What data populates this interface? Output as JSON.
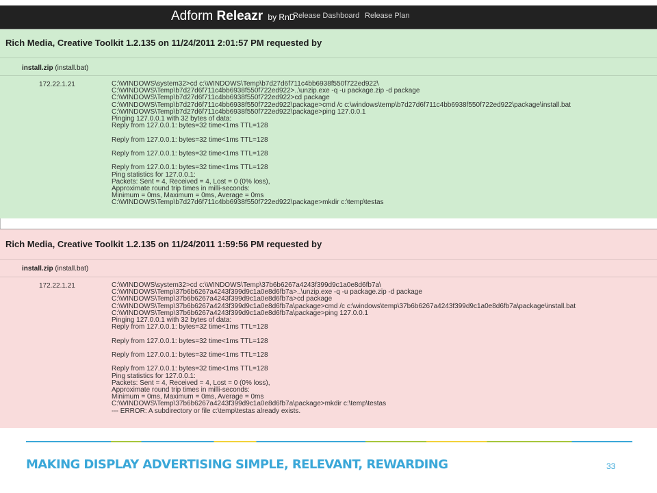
{
  "app": {
    "brand_prefix": "Adform",
    "brand_name": "Releazr",
    "brand_suffix": "by RnD",
    "nav": [
      "Release Dashboard",
      "Release Plan"
    ]
  },
  "requests": [
    {
      "status_color": "#d0ecd0",
      "heading": "Rich Media, Creative Toolkit 1.2.135 on 11/24/2011 2:01:57 PM requested by",
      "file": "install.zip",
      "file_script": "(install.bat)",
      "host": "172.22.1.21",
      "log": [
        "C:\\WINDOWS\\system32>cd c:\\WINDOWS\\Temp\\b7d27d6f711c4bb6938f550f722ed922\\",
        "C:\\WINDOWS\\Temp\\b7d27d6f711c4bb6938f550f722ed922>..\\unzip.exe -q -u package.zip -d package",
        "C:\\WINDOWS\\Temp\\b7d27d6f711c4bb6938f550f722ed922>cd package",
        "C:\\WINDOWS\\Temp\\b7d27d6f711c4bb6938f550f722ed922\\package>cmd /c c:\\windows\\temp\\b7d27d6f711c4bb6938f550f722ed922\\package\\install.bat",
        "C:\\WINDOWS\\Temp\\b7d27d6f711c4bb6938f550f722ed922\\package>ping 127.0.0.1",
        "Pinging 127.0.0.1 with 32 bytes of data:",
        "Reply from 127.0.0.1: bytes=32 time<1ms TTL=128",
        "",
        "Reply from 127.0.0.1: bytes=32 time<1ms TTL=128",
        "",
        "Reply from 127.0.0.1: bytes=32 time<1ms TTL=128",
        "",
        "Reply from 127.0.0.1: bytes=32 time<1ms TTL=128",
        "Ping statistics for 127.0.0.1:",
        "Packets: Sent = 4, Received = 4, Lost = 0 (0% loss),",
        "Approximate round trip times in milli-seconds:",
        "Minimum = 0ms, Maximum = 0ms, Average = 0ms",
        "C:\\WINDOWS\\Temp\\b7d27d6f711c4bb6938f550f722ed922\\package>mkdir c:\\temp\\testas"
      ]
    },
    {
      "status_color": "#f9dcdc",
      "heading": "Rich Media, Creative Toolkit 1.2.135 on 11/24/2011 1:59:56 PM requested by",
      "file": "install.zip",
      "file_script": "(install.bat)",
      "host": "172.22.1.21",
      "log": [
        "C:\\WINDOWS\\system32>cd c:\\WINDOWS\\Temp\\37b6b6267a4243f399d9c1a0e8d6fb7a\\",
        "C:\\WINDOWS\\Temp\\37b6b6267a4243f399d9c1a0e8d6fb7a>..\\unzip.exe -q -u package.zip -d package",
        "C:\\WINDOWS\\Temp\\37b6b6267a4243f399d9c1a0e8d6fb7a>cd package",
        "C:\\WINDOWS\\Temp\\37b6b6267a4243f399d9c1a0e8d6fb7a\\package>cmd /c c:\\windows\\temp\\37b6b6267a4243f399d9c1a0e8d6fb7a\\package\\install.bat",
        "C:\\WINDOWS\\Temp\\37b6b6267a4243f399d9c1a0e8d6fb7a\\package>ping 127.0.0.1",
        "Pinging 127.0.0.1 with 32 bytes of data:",
        "Reply from 127.0.0.1: bytes=32 time<1ms TTL=128",
        "",
        "Reply from 127.0.0.1: bytes=32 time<1ms TTL=128",
        "",
        "Reply from 127.0.0.1: bytes=32 time<1ms TTL=128",
        "",
        "Reply from 127.0.0.1: bytes=32 time<1ms TTL=128",
        "Ping statistics for 127.0.0.1:",
        "Packets: Sent = 4, Received = 4, Lost = 0 (0% loss),",
        "Approximate round trip times in milli-seconds:",
        "Minimum = 0ms, Maximum = 0ms, Average = 0ms",
        "C:\\WINDOWS\\Temp\\37b6b6267a4243f399d9c1a0e8d6fb7a\\package>mkdir c:\\temp\\testas",
        "--- ERROR: A subdirectory or file c:\\temp\\testas already exists."
      ]
    }
  ],
  "footer": {
    "slogan": "MAKING DISPLAY ADVERTISING SIMPLE, RELEVANT, REWARDING",
    "page_number": "33"
  }
}
